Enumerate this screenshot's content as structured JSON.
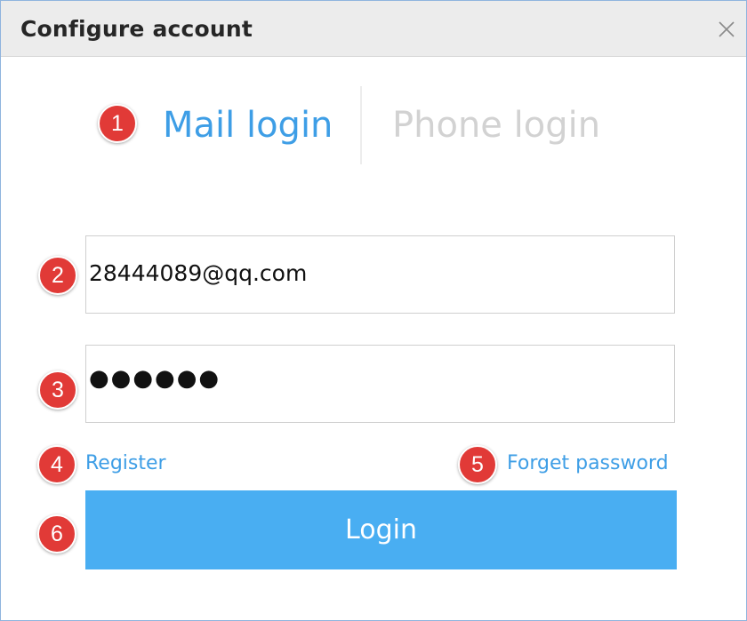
{
  "window": {
    "title": "Configure account",
    "close_icon": "close-icon"
  },
  "tabs": {
    "mail": "Mail login",
    "phone": "Phone login",
    "active": "mail",
    "active_color": "#3e9ee6",
    "inactive_color": "#d2d2d2"
  },
  "form": {
    "email_value": "28444089@qq.com",
    "password_masked": "●●●●●●"
  },
  "links": {
    "register": "Register",
    "forget": "Forget password"
  },
  "login_button": {
    "label": "Login",
    "color": "#49aef2"
  },
  "annotations": {
    "badge_color": "#e13a37",
    "b1": "1",
    "b2": "2",
    "b3": "3",
    "b4": "4",
    "b5": "5",
    "b6": "6"
  }
}
